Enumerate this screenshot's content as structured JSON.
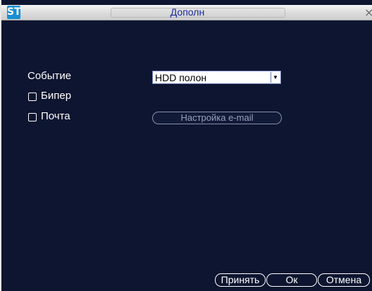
{
  "window": {
    "title": "Дополн",
    "app_icon": "ST",
    "close_icon": "×"
  },
  "form": {
    "event_label": "Событие",
    "event_value": "HDD полон",
    "beeper_label": "Бипер",
    "mail_label": "Почта",
    "email_settings_button": "Настройка e-mail"
  },
  "footer": {
    "apply": "Принять",
    "ok": "Ок",
    "cancel": "Отмена"
  }
}
